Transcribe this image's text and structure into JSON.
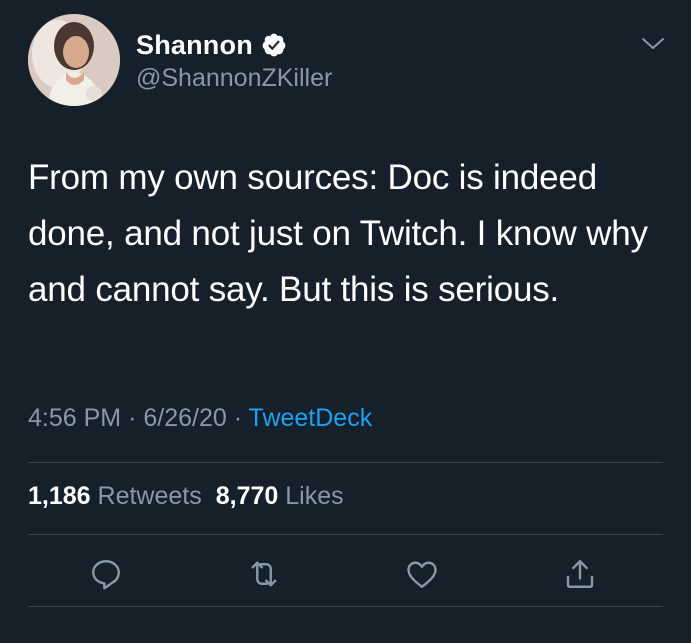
{
  "tweet": {
    "author": {
      "display_name": "Shannon",
      "handle": "@ShannonZKiller",
      "verified": true
    },
    "text": "From my own sources: Doc is indeed done, and not just on Twitch. I know why and cannot say. But this is serious.",
    "meta": {
      "time": "4:56 PM",
      "separator1": "·",
      "date": "6/26/20",
      "separator2": "·",
      "source": "TweetDeck"
    },
    "stats": {
      "retweets_count": "1,186",
      "retweets_label": "Retweets",
      "likes_count": "8,770",
      "likes_label": "Likes"
    },
    "actions": {
      "reply_icon": "reply-icon",
      "retweet_icon": "retweet-icon",
      "like_icon": "heart-icon",
      "share_icon": "share-icon"
    }
  },
  "colors": {
    "background": "#15202b",
    "text": "#ffffff",
    "secondary": "#8899a6",
    "accent": "#1da1f2",
    "divider": "#38444d"
  }
}
